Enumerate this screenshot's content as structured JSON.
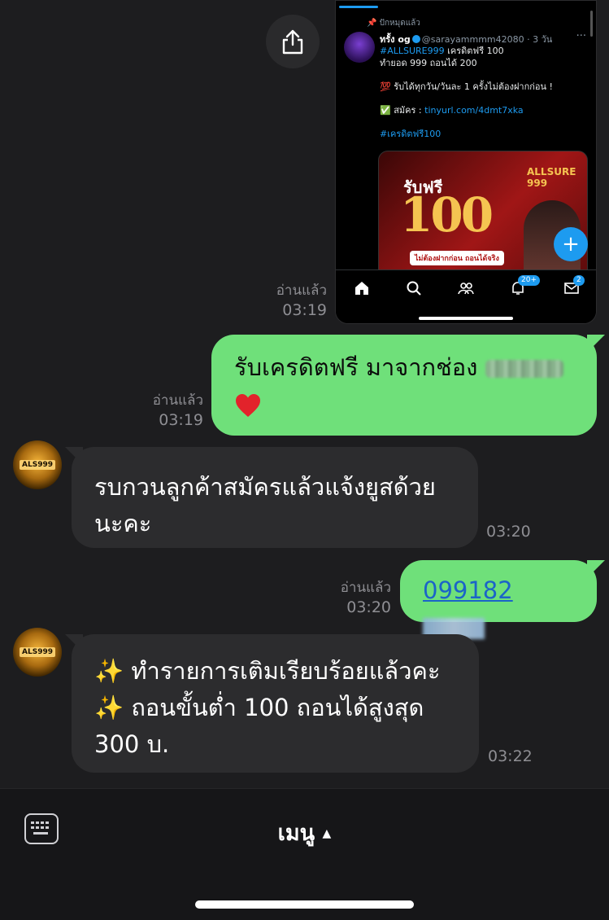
{
  "shared_image": {
    "pinned_label": "ปักหมุดแล้ว",
    "display_name": "ทรั้ง og",
    "handle": "@sarayammmm42080 · 3 วัน",
    "more": "···",
    "hashtag_line": "#ALLSURE999",
    "line1_rest": " เครดิตฟรี 100",
    "line2": "ทำยอด 999 ถอนได้ 200",
    "line3": "💯 รับได้ทุกวัน/วันละ 1 ครั้งไม่ต้องฝากก่อน !",
    "line4_prefix": "✅ สมัคร : ",
    "line4_link": "tinyurl.com/4dmt7xka",
    "line5": "#เครดิตฟรี100",
    "promo_title": "รับฟรี",
    "promo_amount": "100",
    "promo_tag": "ไม่ต้องฝากก่อน ถอนได้จริง",
    "promo_logo": "ALLSURE 999",
    "fab": "+",
    "badge_notifications": "20+",
    "badge_messages": "2"
  },
  "messages": [
    {
      "id": "m1",
      "read": "อ่านแล้ว",
      "time": "03:19"
    },
    {
      "id": "m2",
      "text": "รับเครดิตฟรี มาจากช่อง",
      "read": "อ่านแล้ว",
      "time": "03:19"
    },
    {
      "id": "m3",
      "line1": "รบกวนลูกค้าสมัครแล้วแจ้งยูสด้วย",
      "line2": "นะคะ",
      "time": "03:20"
    },
    {
      "id": "m4",
      "text": "099182",
      "read": "อ่านแล้ว",
      "time": "03:20"
    },
    {
      "id": "m5",
      "line1": "ทำรายการเติมเรียบร้อยแล้วคะ",
      "line2": "ถอนขั้นต่ำ 100 ถอนได้สูงสุด",
      "line3": "300 บ.",
      "emoji": "✨",
      "time": "03:22"
    }
  ],
  "bot_avatar_text": "ALS999",
  "bottom_bar": {
    "menu_label": "เมนู",
    "menu_arrow": "▲"
  }
}
